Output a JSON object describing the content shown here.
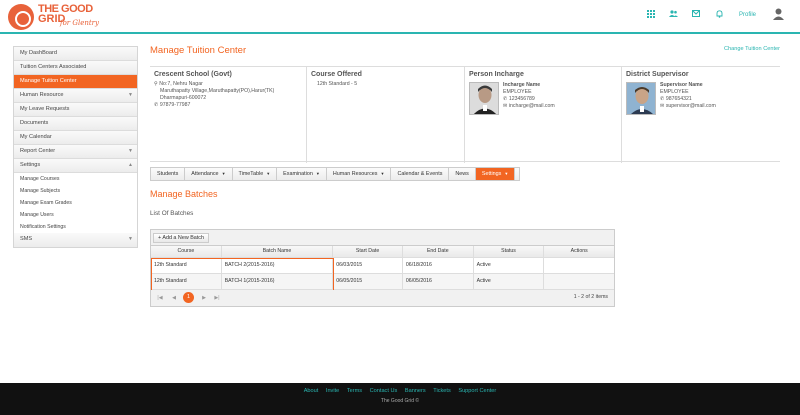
{
  "brand": {
    "line1": "THE GOOD",
    "line2": "GRID",
    "tagline": "for Glentry",
    "accent": "#2ab5b1",
    "primary": "#f26522"
  },
  "header": {
    "icons": [
      "grid-icon",
      "users-icon",
      "mail-icon",
      "bell-icon"
    ],
    "profile_label": "Profile"
  },
  "sidebar": {
    "items": [
      {
        "label": "My DashBoard"
      },
      {
        "label": "Tuition Centers Associated"
      },
      {
        "label": "Manage Tuition Center",
        "active": true
      },
      {
        "label": "Human Resource",
        "caret": true
      },
      {
        "label": "My Leave Requests"
      },
      {
        "label": "Documents"
      },
      {
        "label": "My Calendar"
      },
      {
        "label": "Report Center",
        "caret": true
      },
      {
        "label": "Settings",
        "caret": true,
        "expanded": true
      }
    ],
    "settings_sub": [
      "Manage Courses",
      "Manage Subjects",
      "Manage Exam Grades",
      "Manage Users",
      "Notification Settings"
    ],
    "sms": "SMS"
  },
  "main": {
    "title": "Manage Tuition Center",
    "change_link": "Change Tuition Center",
    "school": {
      "name": "Crescent School (Govt)",
      "addr1": "No:7, Nehru Nagar",
      "addr2": "Maruthapatty Village,Maruthapatty(PO),Harur(TK)",
      "addr3": "Dharmapuri-600072",
      "phone": "97879-77987"
    },
    "course": {
      "heading": "Course Offered",
      "value": "12th Standard - 5"
    },
    "incharge": {
      "heading": "Person Incharge",
      "name": "Incharge Name",
      "role": "EMPLOYEE",
      "phone": "123456789",
      "email": "incharge@mail.com"
    },
    "supervisor": {
      "heading": "District Supervisor",
      "name": "Supervisor Name",
      "role": "EMPLOYEE",
      "phone": "987654321",
      "email": "supervisor@mail.com"
    },
    "tabs": [
      {
        "label": "Students",
        "dd": false
      },
      {
        "label": "Attendance",
        "dd": true
      },
      {
        "label": "TimeTable",
        "dd": true
      },
      {
        "label": "Examination",
        "dd": true
      },
      {
        "label": "Human Resources",
        "dd": true
      },
      {
        "label": "Calendar & Events",
        "dd": false
      },
      {
        "label": "News",
        "dd": false
      },
      {
        "label": "Settings",
        "dd": true,
        "active": true
      }
    ],
    "section_title": "Manage Batches",
    "section_sub": "List Of Batches",
    "grid": {
      "add_button": "+ Add a New Batch",
      "columns": [
        "Course",
        "Batch Name",
        "Start Date",
        "End Date",
        "Status",
        "Actions"
      ],
      "rows": [
        [
          "12th Standard",
          "BATCH 2(2015-2016)",
          "06/03/2015",
          "06/18/2016",
          "Active",
          ""
        ],
        [
          "12th Standard",
          "BATCH 1(2015-2016)",
          "06/05/2015",
          "06/05/2016",
          "Active",
          ""
        ]
      ],
      "pager": {
        "current_page": "1",
        "info": "1 - 2 of 2 items"
      }
    }
  },
  "footer": {
    "links": [
      "About",
      "Invite",
      "Terms",
      "Contact Us",
      "Banners",
      "Tickets",
      "Support Center"
    ],
    "copyright": "The Good Grid ©"
  }
}
